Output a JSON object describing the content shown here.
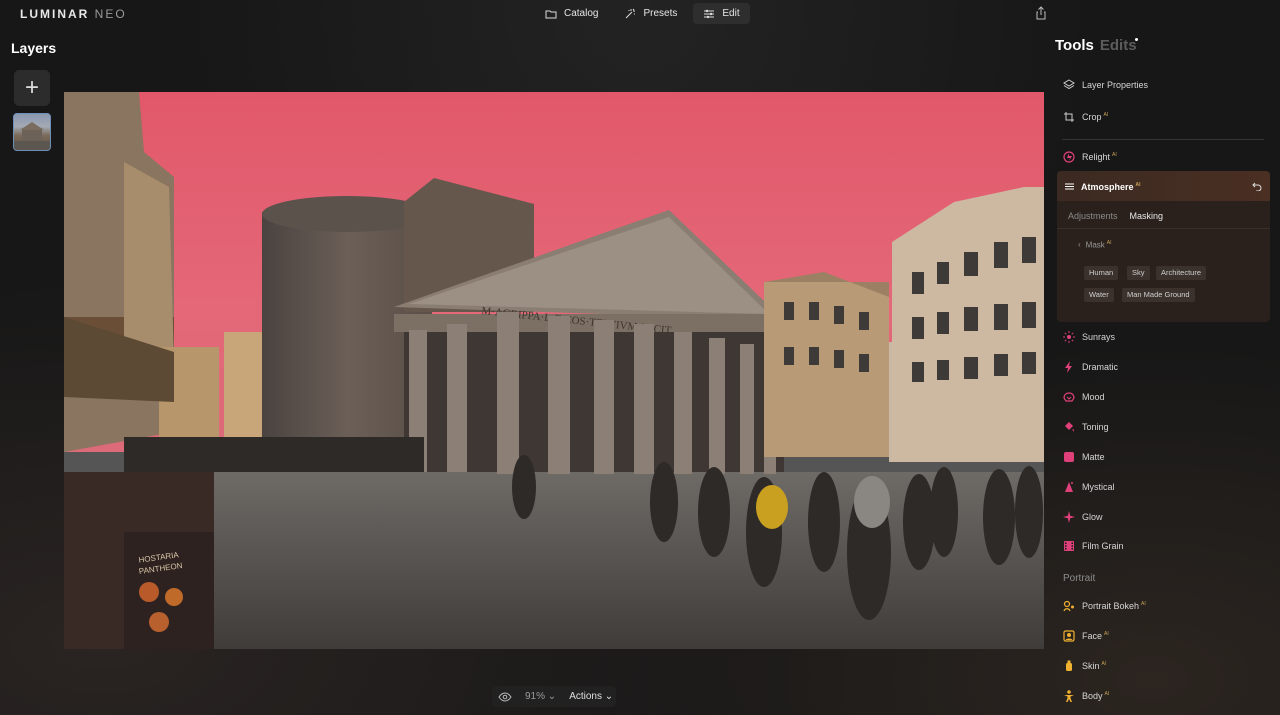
{
  "app": {
    "logo_main": "LUMINAR",
    "logo_sub": "NEO"
  },
  "topnav": {
    "catalog": "Catalog",
    "presets": "Presets",
    "edit": "Edit"
  },
  "layers": {
    "title": "Layers",
    "add_label": "+"
  },
  "bottombar": {
    "zoom": "91%",
    "actions": "Actions"
  },
  "panel": {
    "tab_tools": "Tools",
    "tab_edits": "Edits",
    "ai_badge": "AI",
    "tools_top": [
      {
        "label": "Layer Properties",
        "icon": "layers-icon"
      },
      {
        "label": "Crop",
        "icon": "crop-icon"
      }
    ],
    "relight": "Relight",
    "atmosphere": {
      "title": "Atmosphere",
      "subtab_adjustments": "Adjustments",
      "subtab_masking": "Masking",
      "mask_label": "Mask",
      "chips": [
        "Human",
        "Sky",
        "Architecture",
        "Water",
        "Man Made Ground"
      ]
    },
    "tools_creative": [
      "Sunrays",
      "Dramatic",
      "Mood",
      "Toning",
      "Matte",
      "Mystical",
      "Glow",
      "Film Grain"
    ],
    "portrait_section": "Portrait",
    "tools_portrait": [
      "Portrait Bokeh",
      "Face",
      "Skin",
      "Body"
    ],
    "accent_color": "#e0407a"
  },
  "photo": {
    "inscription": "M·AGRIPPA·L·F·COS·TERTIVM·FECIT",
    "sign_line1": "HOSTARIA",
    "sign_line2": "PANTHEON"
  }
}
